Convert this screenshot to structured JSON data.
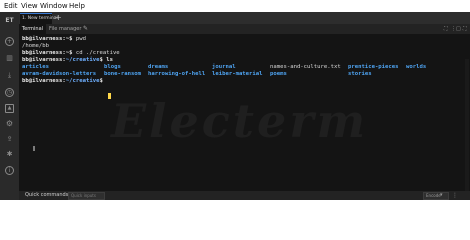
{
  "menu": {
    "items": [
      "Edit",
      "View",
      "Window",
      "Help"
    ]
  },
  "app": {
    "logo": "ET"
  },
  "sidebar": {
    "icons": [
      "plus-circle-icon",
      "book-icon",
      "download-icon",
      "history-icon",
      "image-icon",
      "settings-icon",
      "cloud-upload-icon",
      "bug-icon",
      "info-icon"
    ]
  },
  "tabs": {
    "active_label": "1. New terminal",
    "add_symbol": "+"
  },
  "subtabs": {
    "terminal": "Terminal",
    "file_manager": "File manager",
    "edit_symbol": "✎",
    "right_symbols": [
      "⛶",
      "⋮",
      "□",
      "⛶"
    ]
  },
  "terminal": {
    "line1_prompt": "bb@ilvarness:~$",
    "line1_cmd": " pwd",
    "line2": "/home/bb",
    "line3_prompt": "bb@ilvarness:~$",
    "line3_cmd": " cd ./creative",
    "line4_user": "bb@ilvarness:",
    "line4_path": "~/creative",
    "line4_cmd": "$ ls",
    "ls_row1": [
      "articles",
      "blogs",
      "dreams",
      "journal",
      "names-and-culture.txt",
      "prentice-pieces",
      "worlds"
    ],
    "ls_row2": [
      "avram-davidson-letters",
      "bone-ransom",
      "harrowing-of-hell",
      "leiber-material",
      "poems",
      "stories"
    ],
    "line7_user": "bb@ilvarness:",
    "line7_path": "~/creative",
    "line7_cmd": "$ ",
    "watermark": "Electerm"
  },
  "quickbar": {
    "label": "Quick commands",
    "input_placeholder": "Quick inputs",
    "encode_value": "Encode"
  },
  "colors": {
    "accent": "#3a7bd5",
    "dir": "#4ea3f1",
    "cursor": "#ffd84a",
    "background": "#141414"
  }
}
